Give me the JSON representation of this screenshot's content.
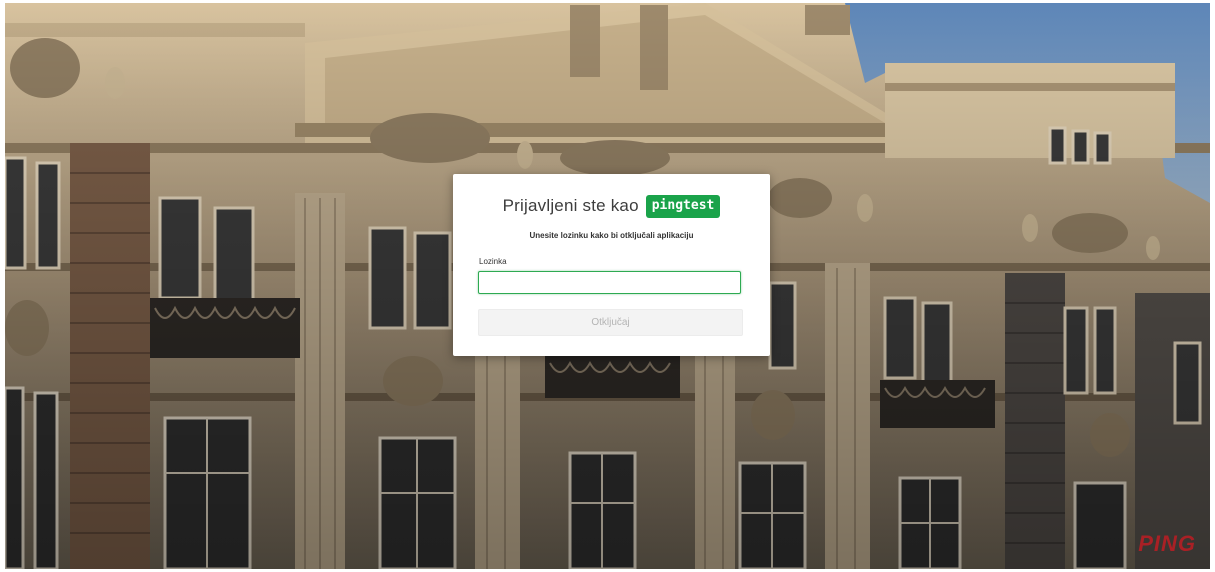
{
  "dialog": {
    "title": "Prijavljeni ste kao",
    "username": "pingtest",
    "subtitle": "Unesite lozinku kako bi otključali aplikaciju",
    "password_label": "Lozinka",
    "password_value": "",
    "unlock_label": "Otključaj"
  },
  "brand": {
    "logo_text": "PING"
  },
  "colors": {
    "badge": "#1aa34a",
    "input_focus_border": "#2eaa52",
    "logo": "#b61e24"
  }
}
